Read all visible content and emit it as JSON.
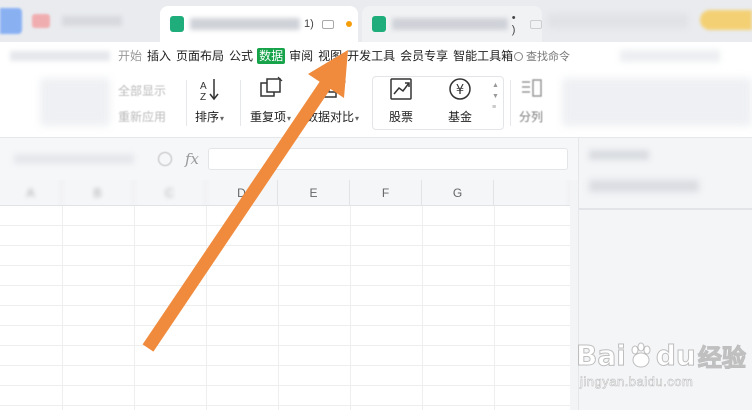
{
  "titlebar": {
    "active_tab": {
      "suffix": "1)"
    },
    "inactive_tab": {
      "suffix": "• )"
    }
  },
  "menu": {
    "items": [
      "开始",
      "插入",
      "页面布局",
      "公式",
      "数据",
      "审阅",
      "视图",
      "开发工具",
      "会员专享",
      "智能工具箱"
    ],
    "active_index": 4,
    "search_label": "查找命令"
  },
  "ribbon": {
    "faded_left_labels": [
      "全部显示",
      "重新应用"
    ],
    "sort_label": "排序",
    "duplicate_label": "重复项",
    "compare_label": "数据对比",
    "stock_label": "股票",
    "fund_label": "基金",
    "split_label": "分列"
  },
  "formula_bar": {
    "fx_label": "fx",
    "value": ""
  },
  "sheet": {
    "columns": [
      "A",
      "B",
      "C",
      "D",
      "E",
      "F",
      "G"
    ]
  },
  "watermark": {
    "brand_left": "Bai",
    "brand_right": "du",
    "brand_cn": "经验",
    "url": "jingyan.baidu.com"
  },
  "colors": {
    "accent_green": "#16a34a",
    "arrow_orange": "#f08a3c",
    "file_icon_green": "#1fae7b",
    "unsaved_dot": "#f59e0b"
  },
  "icons": {
    "sort": "sort-az-icon",
    "duplicate": "duplicate-items-icon",
    "compare": "data-compare-icon",
    "stock": "stock-trend-icon",
    "fund": "yen-circle-icon",
    "split": "text-split-icon",
    "search": "search-icon",
    "monitor": "monitor-icon"
  }
}
